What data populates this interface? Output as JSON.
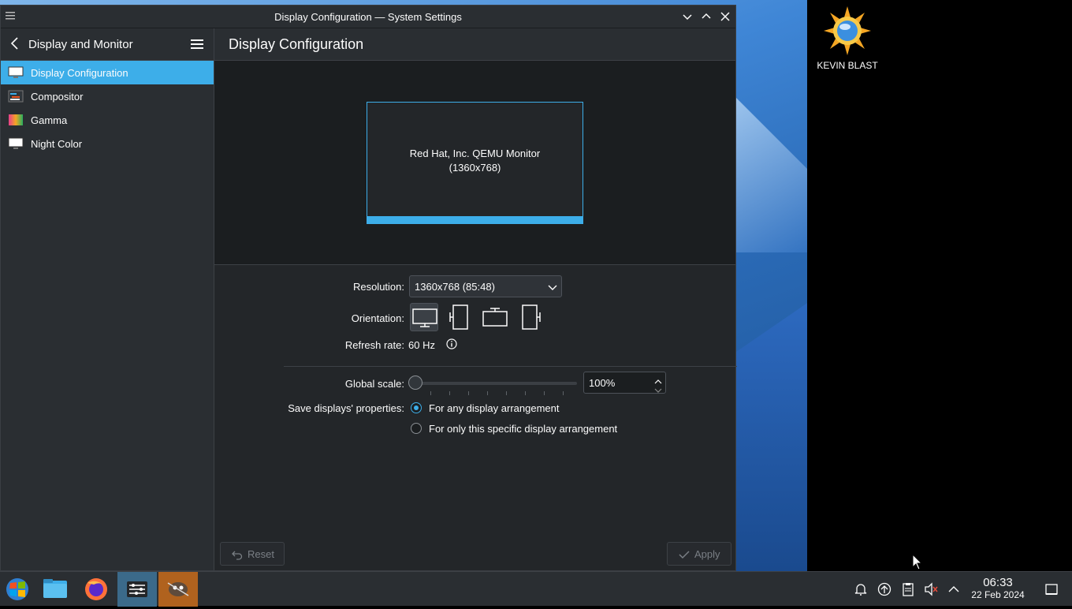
{
  "window": {
    "title": "Display Configuration — System Settings"
  },
  "sidebar": {
    "title": "Display and Monitor",
    "items": [
      {
        "label": "Display Configuration",
        "icon": "display-icon"
      },
      {
        "label": "Compositor",
        "icon": "compositor-icon"
      },
      {
        "label": "Gamma",
        "icon": "gamma-icon"
      },
      {
        "label": "Night Color",
        "icon": "night-color-icon"
      }
    ]
  },
  "main": {
    "title": "Display Configuration",
    "monitor": {
      "name": "Red Hat, Inc. QEMU Monitor",
      "resolution": "(1360x768)"
    },
    "resolution_label": "Resolution:",
    "resolution_value": "1360x768 (85:48)",
    "orientation_label": "Orientation:",
    "refresh_label": "Refresh rate:",
    "refresh_value": "60 Hz",
    "scale_label": "Global scale:",
    "scale_value": "100%",
    "save_label": "Save displays' properties:",
    "save_options": [
      "For any display arrangement",
      "For only this specific display arrangement"
    ],
    "reset_label": "Reset",
    "apply_label": "Apply"
  },
  "desktop": {
    "icon_label": "KEVIN BLAST"
  },
  "taskbar": {
    "time": "06:33",
    "date": "22 Feb 2024"
  },
  "colors": {
    "accent": "#3daee9",
    "window_bg": "#232629",
    "panel_bg": "#2a2e32"
  }
}
